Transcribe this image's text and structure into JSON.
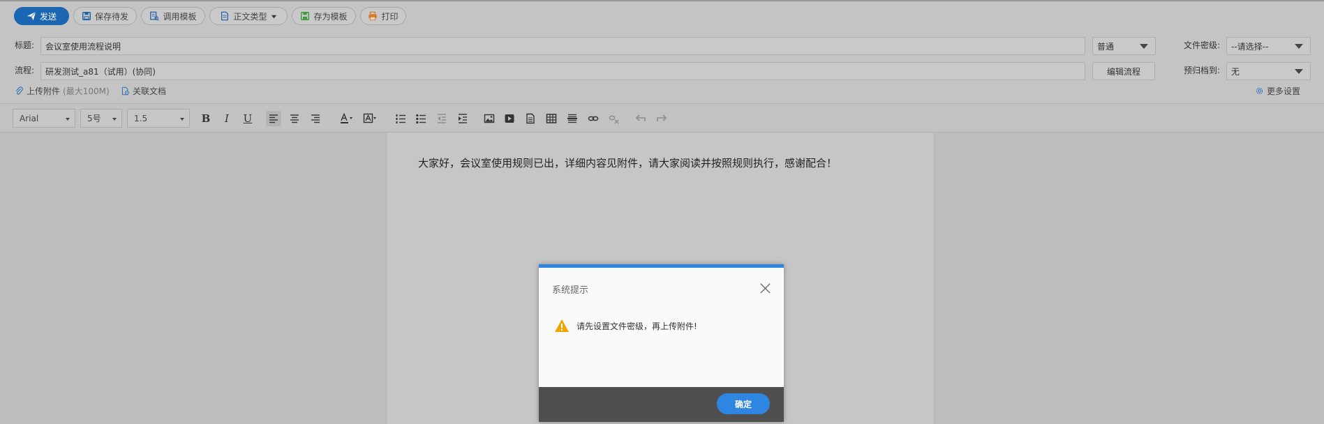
{
  "toolbar": {
    "send_label": "发送",
    "save_draft_label": "保存待发",
    "template_label": "调用模板",
    "body_type_label": "正文类型",
    "save_template_label": "存为模板",
    "print_label": "打印"
  },
  "form": {
    "title_label": "标题:",
    "title_value": "会议室使用流程说明",
    "priority_value": "普通",
    "secret_label": "文件密级:",
    "secret_value": "--请选择--",
    "flow_label": "流程:",
    "flow_value": "研发测试_a81（试用）(协同)",
    "edit_flow_label": "编辑流程",
    "archive_label": "预归档到:",
    "archive_value": "无",
    "upload_label": "上传附件",
    "upload_hint": "(最大100M)",
    "related_doc_label": "关联文档",
    "more_settings_label": "更多设置"
  },
  "editor": {
    "font_family": "Arial",
    "font_size": "5号",
    "line_height": "1.5",
    "bold_glyph": "B",
    "italic_glyph": "I",
    "underline_glyph": "U",
    "content": "大家好，会议室使用规则已出，详细内容见附件，请大家阅读并按照规则执行，感谢配合！"
  },
  "modal": {
    "title": "系统提示",
    "message": "请先设置文件密级，再上传附件!",
    "ok_label": "确定"
  },
  "colors": {
    "primary": "#2f86e0",
    "warning": "#f0a400",
    "overlay_footer": "#4f4f4f"
  }
}
